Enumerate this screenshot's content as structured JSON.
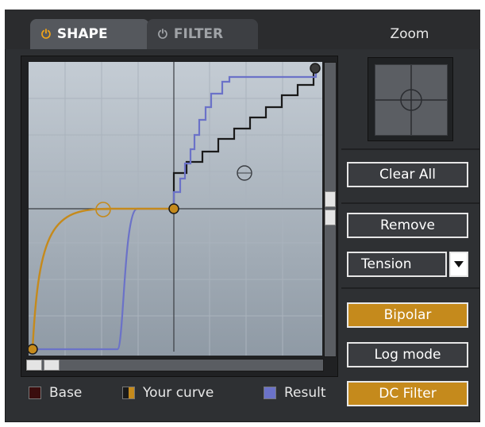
{
  "tabs": [
    {
      "label": "SHAPE",
      "active": true
    },
    {
      "label": "FILTER",
      "active": false
    }
  ],
  "icons": {
    "power": "power-icon",
    "dropdown": "triangle-down-icon"
  },
  "zoom": {
    "label": "Zoom"
  },
  "buttons": {
    "clear_all": "Clear All",
    "remove": "Remove",
    "tension": "Tension",
    "bipolar": "Bipolar",
    "log_mode": "Log mode",
    "dc_filter": "DC Filter"
  },
  "legend": [
    {
      "label": "Base",
      "color": "#3a0d0d"
    },
    {
      "label": "Your curve",
      "color": "#c58a1c"
    },
    {
      "label": "Result",
      "color": "#6b72c8"
    }
  ],
  "colors": {
    "accent": "#c58a1c",
    "result": "#6b72c8",
    "base": "#1a1a1a",
    "grid_bg": "#aeb7c0"
  }
}
